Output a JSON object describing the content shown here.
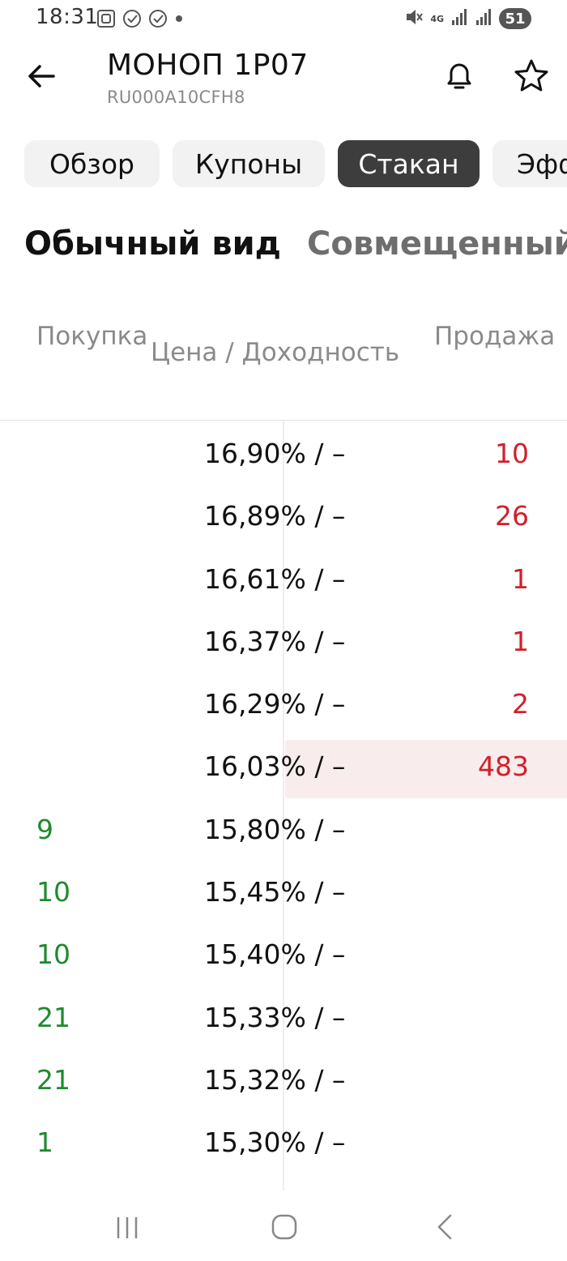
{
  "status_bar": {
    "time": "18:31",
    "network": "4G",
    "battery": "51",
    "icons": [
      "screenshot-icon",
      "check-circle-icon",
      "check-circle-icon",
      "dot-icon",
      "mute-icon",
      "signal-icon",
      "signal-icon"
    ]
  },
  "header": {
    "title": "МОНОП 1Р07",
    "isin": "RU000A10CFH8"
  },
  "tabs": [
    {
      "label": "Обзор",
      "active": false
    },
    {
      "label": "Купоны",
      "active": false
    },
    {
      "label": "Стакан",
      "active": true
    },
    {
      "label": "Эфф",
      "active": false
    }
  ],
  "views": {
    "normal": "Обычный вид",
    "combined": "Совмещенный вид"
  },
  "table": {
    "headers": {
      "buy": "Покупка",
      "price": "Цена / Доходность",
      "sell": "Продажа"
    },
    "rows": [
      {
        "buy": "",
        "price": "16,90% / –",
        "sell": "10"
      },
      {
        "buy": "",
        "price": "16,89% / –",
        "sell": "26"
      },
      {
        "buy": "",
        "price": "16,61% / –",
        "sell": "1"
      },
      {
        "buy": "",
        "price": "16,37% / –",
        "sell": "1"
      },
      {
        "buy": "",
        "price": "16,29% / –",
        "sell": "2"
      },
      {
        "buy": "",
        "price": "16,03% / –",
        "sell": "483"
      },
      {
        "buy": "9",
        "price": "15,80% / –",
        "sell": ""
      },
      {
        "buy": "10",
        "price": "15,45% / –",
        "sell": ""
      },
      {
        "buy": "10",
        "price": "15,40% / –",
        "sell": ""
      },
      {
        "buy": "21",
        "price": "15,33% / –",
        "sell": ""
      },
      {
        "buy": "21",
        "price": "15,32% / –",
        "sell": ""
      },
      {
        "buy": "1",
        "price": "15,30% / –",
        "sell": ""
      }
    ]
  },
  "colors": {
    "buy": "#1f8a2e",
    "sell": "#d0202a",
    "active_tab": "#3d3d3d",
    "best_ask_highlight": "#f9ecec"
  }
}
